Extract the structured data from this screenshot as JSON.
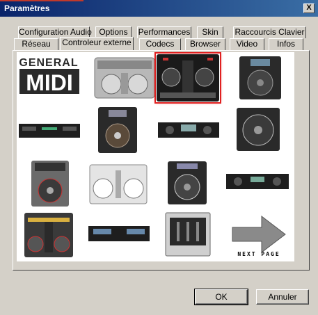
{
  "window": {
    "title": "Paramètres",
    "close_glyph": "X"
  },
  "tabs_row1": [
    {
      "label": "Configuration Audio"
    },
    {
      "label": "Options"
    },
    {
      "label": "Performances"
    },
    {
      "label": "Skin"
    },
    {
      "label": "Raccourcis Clavier"
    }
  ],
  "tabs_row2": [
    {
      "label": "Réseau"
    },
    {
      "label": "Controleur externe",
      "active": true
    },
    {
      "label": "Codecs"
    },
    {
      "label": "Browser"
    },
    {
      "label": "Video"
    },
    {
      "label": "Infos"
    }
  ],
  "controllers": {
    "selected_index": 2,
    "selection_color": "#e02020",
    "logo_line1": "GENERAL",
    "logo_line2": "MIDI",
    "next_page_label": "NEXT PAGE"
  },
  "buttons": {
    "ok": "OK",
    "cancel": "Annuler"
  }
}
